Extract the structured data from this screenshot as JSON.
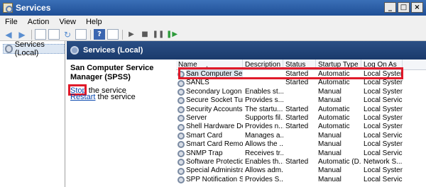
{
  "window": {
    "title": "Services",
    "minimize_glyph": "_",
    "maximize_glyph": "□",
    "close_glyph": "×"
  },
  "menu": [
    "File",
    "Action",
    "View",
    "Help"
  ],
  "toolbar": {
    "icons": [
      "back-arrow-icon",
      "forward-arrow-icon",
      "console-tree-icon",
      "properties-icon",
      "refresh-icon",
      "export-list-icon",
      "help-icon",
      "view-icon",
      "start-service-icon",
      "stop-service-icon",
      "pause-service-icon",
      "restart-service-icon"
    ]
  },
  "tree": {
    "selected_label": "Services (Local)"
  },
  "panel": {
    "header": "Services (Local)",
    "service_title": "San Computer Service Manager (SPSS)",
    "stop_link": "Stop",
    "stop_suffix": " the service",
    "restart_link": "Restart",
    "restart_suffix": " the service"
  },
  "columns": {
    "name": "Name",
    "description": "Description",
    "status": "Status",
    "startup_type": "Startup Type",
    "log_on_as": "Log On As"
  },
  "services": [
    {
      "name": "San Computer Serv...",
      "description": "",
      "status": "Started",
      "startup": "Automatic",
      "logon": "Local System"
    },
    {
      "name": "SANLS",
      "description": "",
      "status": "Started",
      "startup": "Automatic",
      "logon": "Local System"
    },
    {
      "name": "Secondary Logon",
      "description": "Enables st...",
      "status": "",
      "startup": "Manual",
      "logon": "Local System"
    },
    {
      "name": "Secure Socket Tun...",
      "description": "Provides s...",
      "status": "",
      "startup": "Manual",
      "logon": "Local Service"
    },
    {
      "name": "Security Accounts ...",
      "description": "The startu...",
      "status": "Started",
      "startup": "Automatic",
      "logon": "Local System"
    },
    {
      "name": "Server",
      "description": "Supports fil...",
      "status": "Started",
      "startup": "Automatic",
      "logon": "Local System"
    },
    {
      "name": "Shell Hardware Det...",
      "description": "Provides n...",
      "status": "Started",
      "startup": "Automatic",
      "logon": "Local System"
    },
    {
      "name": "Smart Card",
      "description": "Manages a...",
      "status": "",
      "startup": "Manual",
      "logon": "Local Service"
    },
    {
      "name": "Smart Card Remov...",
      "description": "Allows the ...",
      "status": "",
      "startup": "Manual",
      "logon": "Local System"
    },
    {
      "name": "SNMP Trap",
      "description": "Receives tr...",
      "status": "",
      "startup": "Manual",
      "logon": "Local Service"
    },
    {
      "name": "Software Protection",
      "description": "Enables th...",
      "status": "Started",
      "startup": "Automatic (D...",
      "logon": "Network S..."
    },
    {
      "name": "Special Administrati...",
      "description": "Allows adm...",
      "status": "",
      "startup": "Manual",
      "logon": "Local System"
    },
    {
      "name": "SPP Notification Ser...",
      "description": "Provides S...",
      "status": "",
      "startup": "Manual",
      "logon": "Local Service"
    }
  ],
  "colors": {
    "highlight": "#e01a2a",
    "header_blue": "#1a3a6c",
    "link": "#0645ad"
  }
}
